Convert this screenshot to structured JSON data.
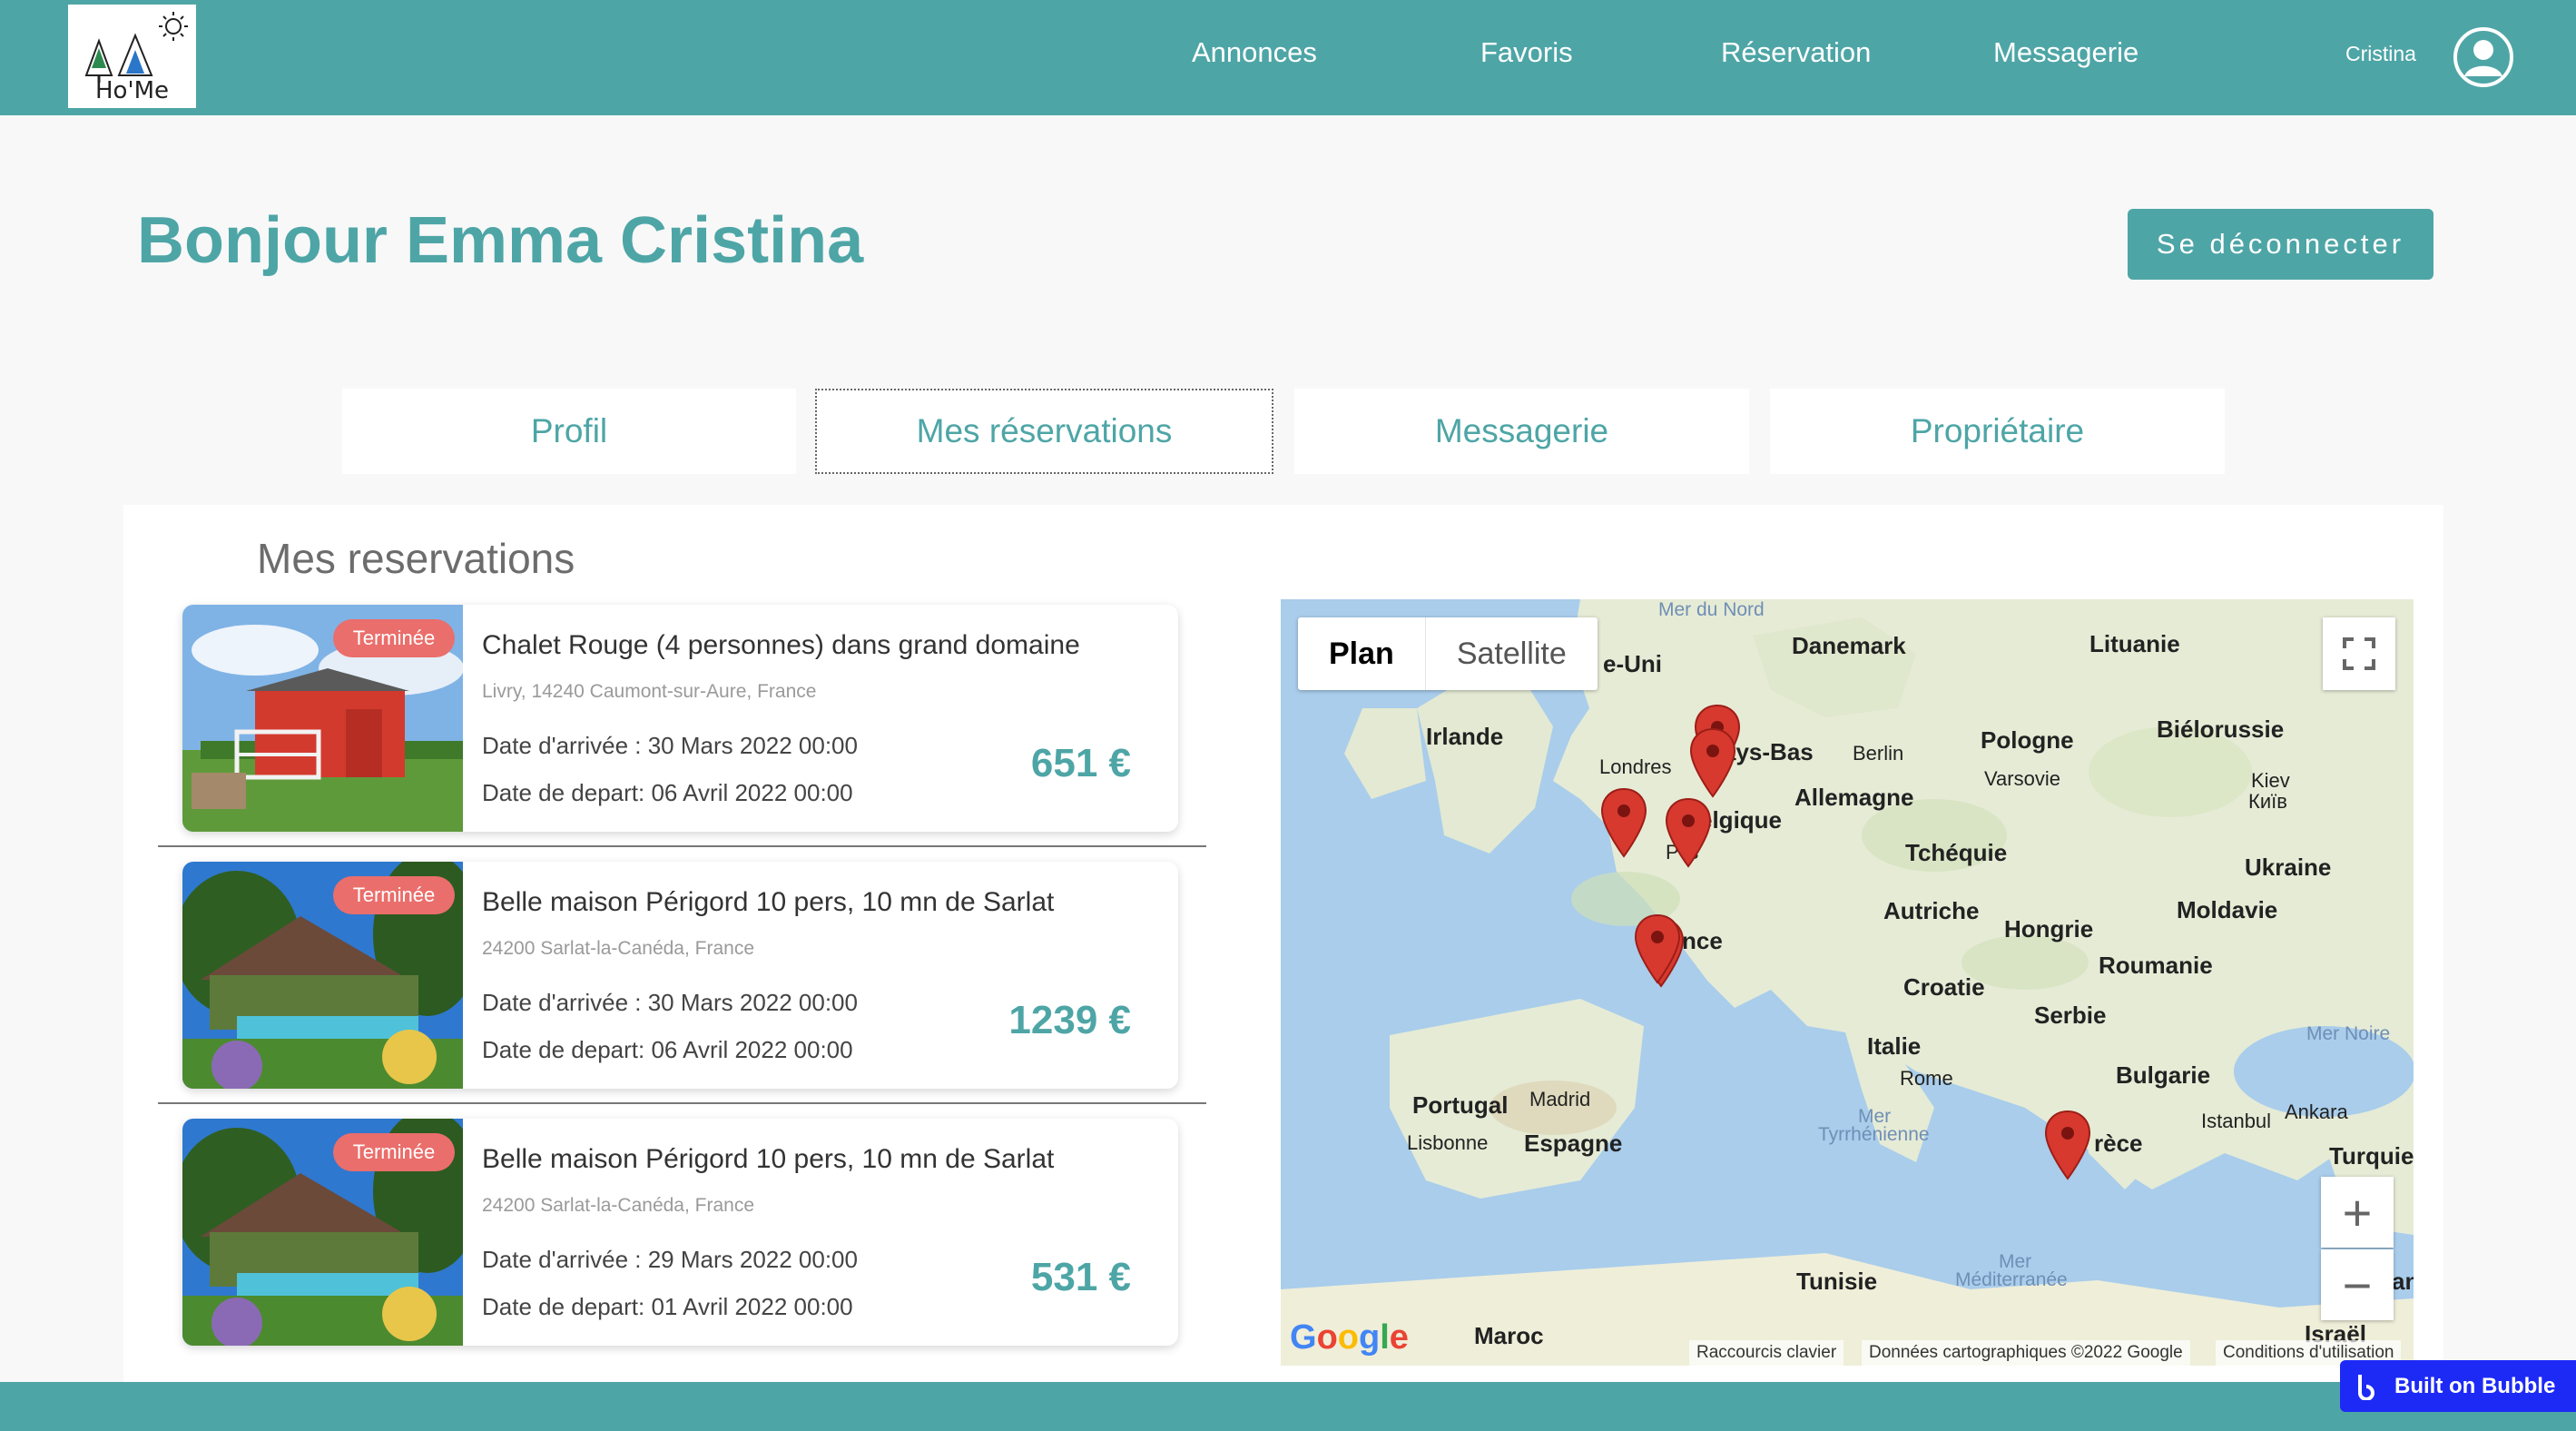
{
  "app": {
    "logo_text": "Ho'Me",
    "brand_color": "#4ea5a6"
  },
  "nav": {
    "links": [
      {
        "label": "Annonces"
      },
      {
        "label": "Favoris"
      },
      {
        "label": "Réservation"
      },
      {
        "label": "Messagerie"
      }
    ],
    "user_name": "Cristina",
    "avatar_icon": "user-circle-icon"
  },
  "greeting": "Bonjour Emma Cristina",
  "logout_label": "Se déconnecter",
  "tabs": [
    {
      "label": "Profil",
      "active": false
    },
    {
      "label": "Mes réservations",
      "active": true
    },
    {
      "label": "Messagerie",
      "active": false
    },
    {
      "label": "Propriétaire",
      "active": false
    }
  ],
  "section_title": "Mes reservations",
  "reservations": [
    {
      "status": "Terminée",
      "title": "Chalet Rouge (4 personnes) dans grand domaine",
      "address": "Livry, 14240 Caumont-sur-Aure, France",
      "arrival": "Date d'arrivée : 30 Mars 2022 00:00",
      "departure": "Date de depart: 06 Avril 2022 00:00",
      "price": "651 €"
    },
    {
      "status": "Terminée",
      "title": "Belle maison Périgord 10 pers, 10 mn de Sarlat",
      "address": "24200 Sarlat-la-Canéda, France",
      "arrival": "Date d'arrivée : 30 Mars 2022 00:00",
      "departure": "Date de depart: 06 Avril 2022 00:00",
      "price": "1239 €"
    },
    {
      "status": "Terminée",
      "title": "Belle maison Périgord 10 pers, 10 mn de Sarlat",
      "address": "24200 Sarlat-la-Canéda, France",
      "arrival": "Date d'arrivée : 29 Mars 2022 00:00",
      "departure": "Date de depart: 01 Avril 2022 00:00",
      "price": "531 €"
    }
  ],
  "map": {
    "type_plan": "Plan",
    "type_satellite": "Satellite",
    "labels": {
      "mer_du_nord": "Mer du Nord",
      "danemark": "Danemark",
      "lituanie": "Lituanie",
      "royaume_uni": "e-Uni",
      "irlande": "Irlande",
      "pays_bas": "ays-Bas",
      "berlin": "Berlin",
      "pologne": "Pologne",
      "bielorussie": "Biélorussie",
      "londres": "Londres",
      "allemagne": "Allemagne",
      "varsovie": "Varsovie",
      "kiev": "Kiev",
      "kiev_cyr": "Київ",
      "belgique": "elgique",
      "paris": "P  is",
      "tcheque": "Tchéquie",
      "ukraine": "Ukraine",
      "autriche": "Autriche",
      "moldavie": "Moldavie",
      "france": "nce",
      "hongrie": "Hongrie",
      "roumanie": "Roumanie",
      "croatie": "Croatie",
      "serbie": "Serbie",
      "mer_noire": "Mer Noire",
      "italie": "Italie",
      "rome": "Rome",
      "bulgarie": "Bulgarie",
      "portugal": "Portugal",
      "madrid": "Madrid",
      "espagne": "Espagne",
      "lisbonne": "Lisbonne",
      "istanbul": "Istanbul",
      "ankara": "Ankara",
      "turquie": "Turquie",
      "grece": "rèce",
      "mer_tyr_1": "Mer",
      "mer_tyr_2": "Tyrrhénienne",
      "mer_med_1": "Mer",
      "mer_med_2": "Méditerranée",
      "tunisie": "Tunisie",
      "maroc": "Maroc",
      "israel": "Israël",
      "an": "an"
    },
    "footer": {
      "shortcuts": "Raccourcis clavier",
      "data": "Données cartographiques ©2022 Google",
      "terms": "Conditions d'utilisation"
    },
    "google_logo": "Google",
    "zoom_in": "+",
    "zoom_out": "−",
    "fullscreen_icon": "fullscreen-icon"
  },
  "bubble_label": "Built on Bubble"
}
